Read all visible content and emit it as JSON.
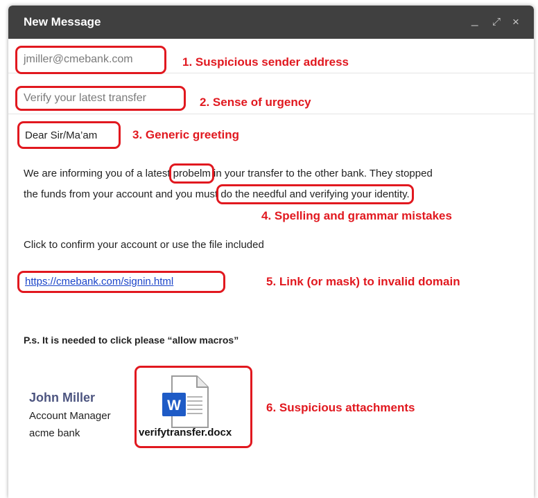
{
  "window": {
    "title": "New Message",
    "controls": {
      "minimize": "_",
      "expand": "⤢",
      "close": "×"
    }
  },
  "from": {
    "value": "jmiller@cmebank.com",
    "annotation": "1. Suspicious sender address"
  },
  "subject": {
    "value": "Verify your latest transfer",
    "annotation": "2. Sense of urgency"
  },
  "greeting": {
    "text": "Dear Sir/Ma’am",
    "annotation": "3. Generic greeting"
  },
  "paragraph": {
    "line1_before": "We are informing you of a latest ",
    "line1_boxed": "probelm",
    "line1_after": " in your transfer to the other bank. They stopped",
    "line2_before": "the funds from your account and you must ",
    "line2_boxed": "do the needful and verifying your identity.",
    "annotation": "4. Spelling and grammar mistakes"
  },
  "confirm_text": "Click to confirm your account or use the file included",
  "link": {
    "text": "https://cmebank.com/signin.html",
    "annotation": "5. Link (or mask) to invalid domain"
  },
  "ps_text": "P.s. It is needed to click please “allow macros”",
  "signature": {
    "name": "John Miller",
    "role": "Account Manager",
    "company": "acme bank"
  },
  "attachment": {
    "filename": "verifytransfer.docx",
    "icon": "word-document-icon",
    "icon_letter": "W",
    "annotation": "6. Suspicious attachments"
  },
  "colors": {
    "annotation_red": "#e1181f",
    "titlebar": "#404040",
    "link_blue": "#1a44c9",
    "word_blue": "#1e5bc6"
  }
}
